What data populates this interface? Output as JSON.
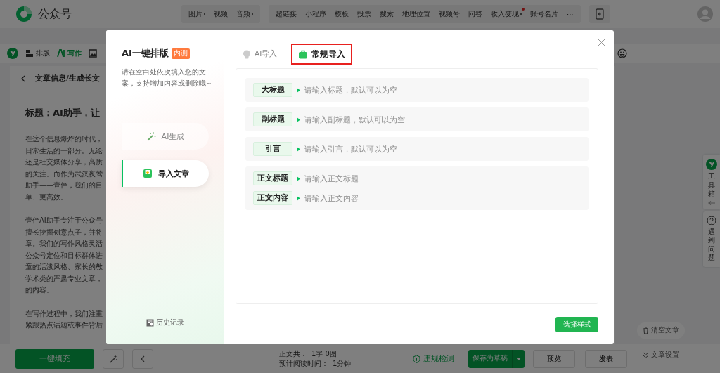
{
  "topbar": {
    "brand": "公众号",
    "nav_groups": [
      [
        {
          "label": "图片",
          "dropdown": true,
          "dot": false
        },
        {
          "label": "视频",
          "dropdown": false,
          "dot": false
        },
        {
          "label": "音频",
          "dropdown": true,
          "dot": false
        }
      ],
      [
        {
          "label": "超链接",
          "dropdown": false,
          "dot": false
        },
        {
          "label": "小程序",
          "dropdown": false,
          "dot": false
        },
        {
          "label": "模板",
          "dropdown": false,
          "dot": false
        },
        {
          "label": "投票",
          "dropdown": false,
          "dot": false
        },
        {
          "label": "搜索",
          "dropdown": false,
          "dot": false
        },
        {
          "label": "地理位置",
          "dropdown": false,
          "dot": false
        },
        {
          "label": "视频号",
          "dropdown": false,
          "dot": false
        },
        {
          "label": "问答",
          "dropdown": false,
          "dot": false
        },
        {
          "label": "收入变现",
          "dropdown": true,
          "dot": true
        },
        {
          "label": "账号名片",
          "dropdown": false,
          "dot": false
        },
        {
          "label": "···",
          "dropdown": false,
          "dot": false
        }
      ]
    ]
  },
  "editor_toolbar": {
    "items": [
      {
        "kind": "layout",
        "label": "排版",
        "selected": false
      },
      {
        "kind": "write",
        "label": "写作",
        "selected": true
      }
    ]
  },
  "article_panel": {
    "breadcrumb": "文章信息/生成长文",
    "title": "标题：AI助手，让",
    "paragraphs": [
      [
        "在这个信息爆炸的时代，",
        "日常生活的一部分。无论",
        "还是社交媒体分享，高质",
        "的关注。而作为武汉夜莺",
        "助手——壹伴，我们的目",
        "单、更高效。"
      ],
      [
        "壹伴AI助手专注于公众号",
        "擅长挖掘创意点子，并将",
        "章。我们的写作风格灵活",
        "公众号定位和目标群体进",
        "童的活泼风格、家长的教",
        "学术类的严肃专业文章，",
        "的内容。"
      ],
      [
        "在写作过程中，我们注重",
        "紧跟热点话题或事件背后"
      ]
    ],
    "fill_button": "一键填充"
  },
  "status": {
    "word_count_label": "正文共：",
    "word_count": "1字 0图",
    "read_time_label": "预计阅读时间：",
    "read_time": "1分钟"
  },
  "actions": {
    "check": "违规检测",
    "save": "保存为草稿",
    "preview": "预览",
    "publish": "发表"
  },
  "side_buttons": [
    {
      "kind": "clear",
      "label": "清空文章"
    },
    {
      "kind": "settings",
      "label": "文章设置"
    }
  ],
  "float_tabs": [
    {
      "kind": "toolbox",
      "label": "工具箱"
    },
    {
      "kind": "help",
      "label": "遇到问题"
    }
  ],
  "modal": {
    "title": "AI一键排版",
    "badge": "内测",
    "description": "请在空白处依次填入您的文案，支持增加内容或删除哦~",
    "modes": [
      {
        "kind": "generate",
        "label": "AI生成",
        "selected": false
      },
      {
        "kind": "import",
        "label": "导入文章",
        "selected": true
      }
    ],
    "history": "历史记录",
    "tabs": [
      {
        "kind": "ai",
        "label": "AI导入",
        "selected": false,
        "highlighted": false
      },
      {
        "kind": "regular",
        "label": "常规导入",
        "selected": true,
        "highlighted": true
      }
    ],
    "groups": [
      [
        {
          "label": "大标题",
          "placeholder": "请输入标题，默认可以为空"
        }
      ],
      [
        {
          "label": "副标题",
          "placeholder": "请输入副标题，默认可以为空"
        }
      ],
      [
        {
          "label": "引言",
          "placeholder": "请输入引言，默认可以为空"
        }
      ],
      [
        {
          "label": "正文标题",
          "placeholder": "请输入正文标题"
        },
        {
          "label": "正文内容",
          "placeholder": "请输入正文内容"
        }
      ]
    ],
    "confirm_button": "选择样式"
  }
}
